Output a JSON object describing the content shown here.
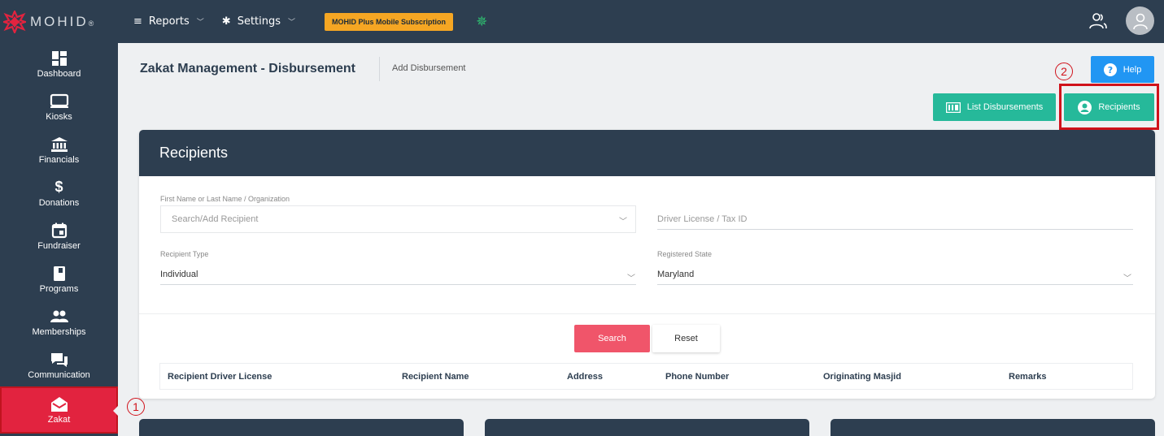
{
  "topbar": {
    "logo_text": "MOHID",
    "logo_reg": "®",
    "reports_label": "Reports",
    "settings_label": "Settings",
    "subscription_label": "MOHID Plus Mobile Subscription",
    "colors": {
      "bg": "#2d3e50",
      "subscription": "#f5a623",
      "accent_green": "#2fbf71",
      "logo_red": "#e2233f"
    }
  },
  "sidebar": {
    "items": [
      {
        "label": "Dashboard",
        "icon": "dashboard-icon"
      },
      {
        "label": "Kiosks",
        "icon": "monitor-icon"
      },
      {
        "label": "Financials",
        "icon": "bank-icon"
      },
      {
        "label": "Donations",
        "icon": "dollar-icon"
      },
      {
        "label": "Fundraiser",
        "icon": "calendar-icon"
      },
      {
        "label": "Programs",
        "icon": "book-icon"
      },
      {
        "label": "Memberships",
        "icon": "people-icon"
      },
      {
        "label": "Communication",
        "icon": "chat-icon"
      },
      {
        "label": "Zakat",
        "icon": "envelope-icon",
        "active": true
      }
    ],
    "active_color": "#e2233f"
  },
  "annotations": {
    "one": "1",
    "two": "2"
  },
  "header": {
    "title": "Zakat Management - Disbursement",
    "breadcrumb": "Add Disbursement",
    "help_label": "Help",
    "list_label": "List Disbursements",
    "recipients_label": "Recipients"
  },
  "card": {
    "title": "Recipients",
    "name_label": "First Name or Last Name / Organization",
    "name_placeholder": "Search/Add Recipient",
    "license_placeholder": "Driver License / Tax ID",
    "type_label": "Recipient Type",
    "type_value": "Individual",
    "state_label": "Registered State",
    "state_value": "Maryland",
    "search_label": "Search",
    "reset_label": "Reset",
    "columns": [
      "Recipient Driver License",
      "Recipient Name",
      "Address",
      "Phone Number",
      "Originating Masjid",
      "Remarks"
    ]
  }
}
